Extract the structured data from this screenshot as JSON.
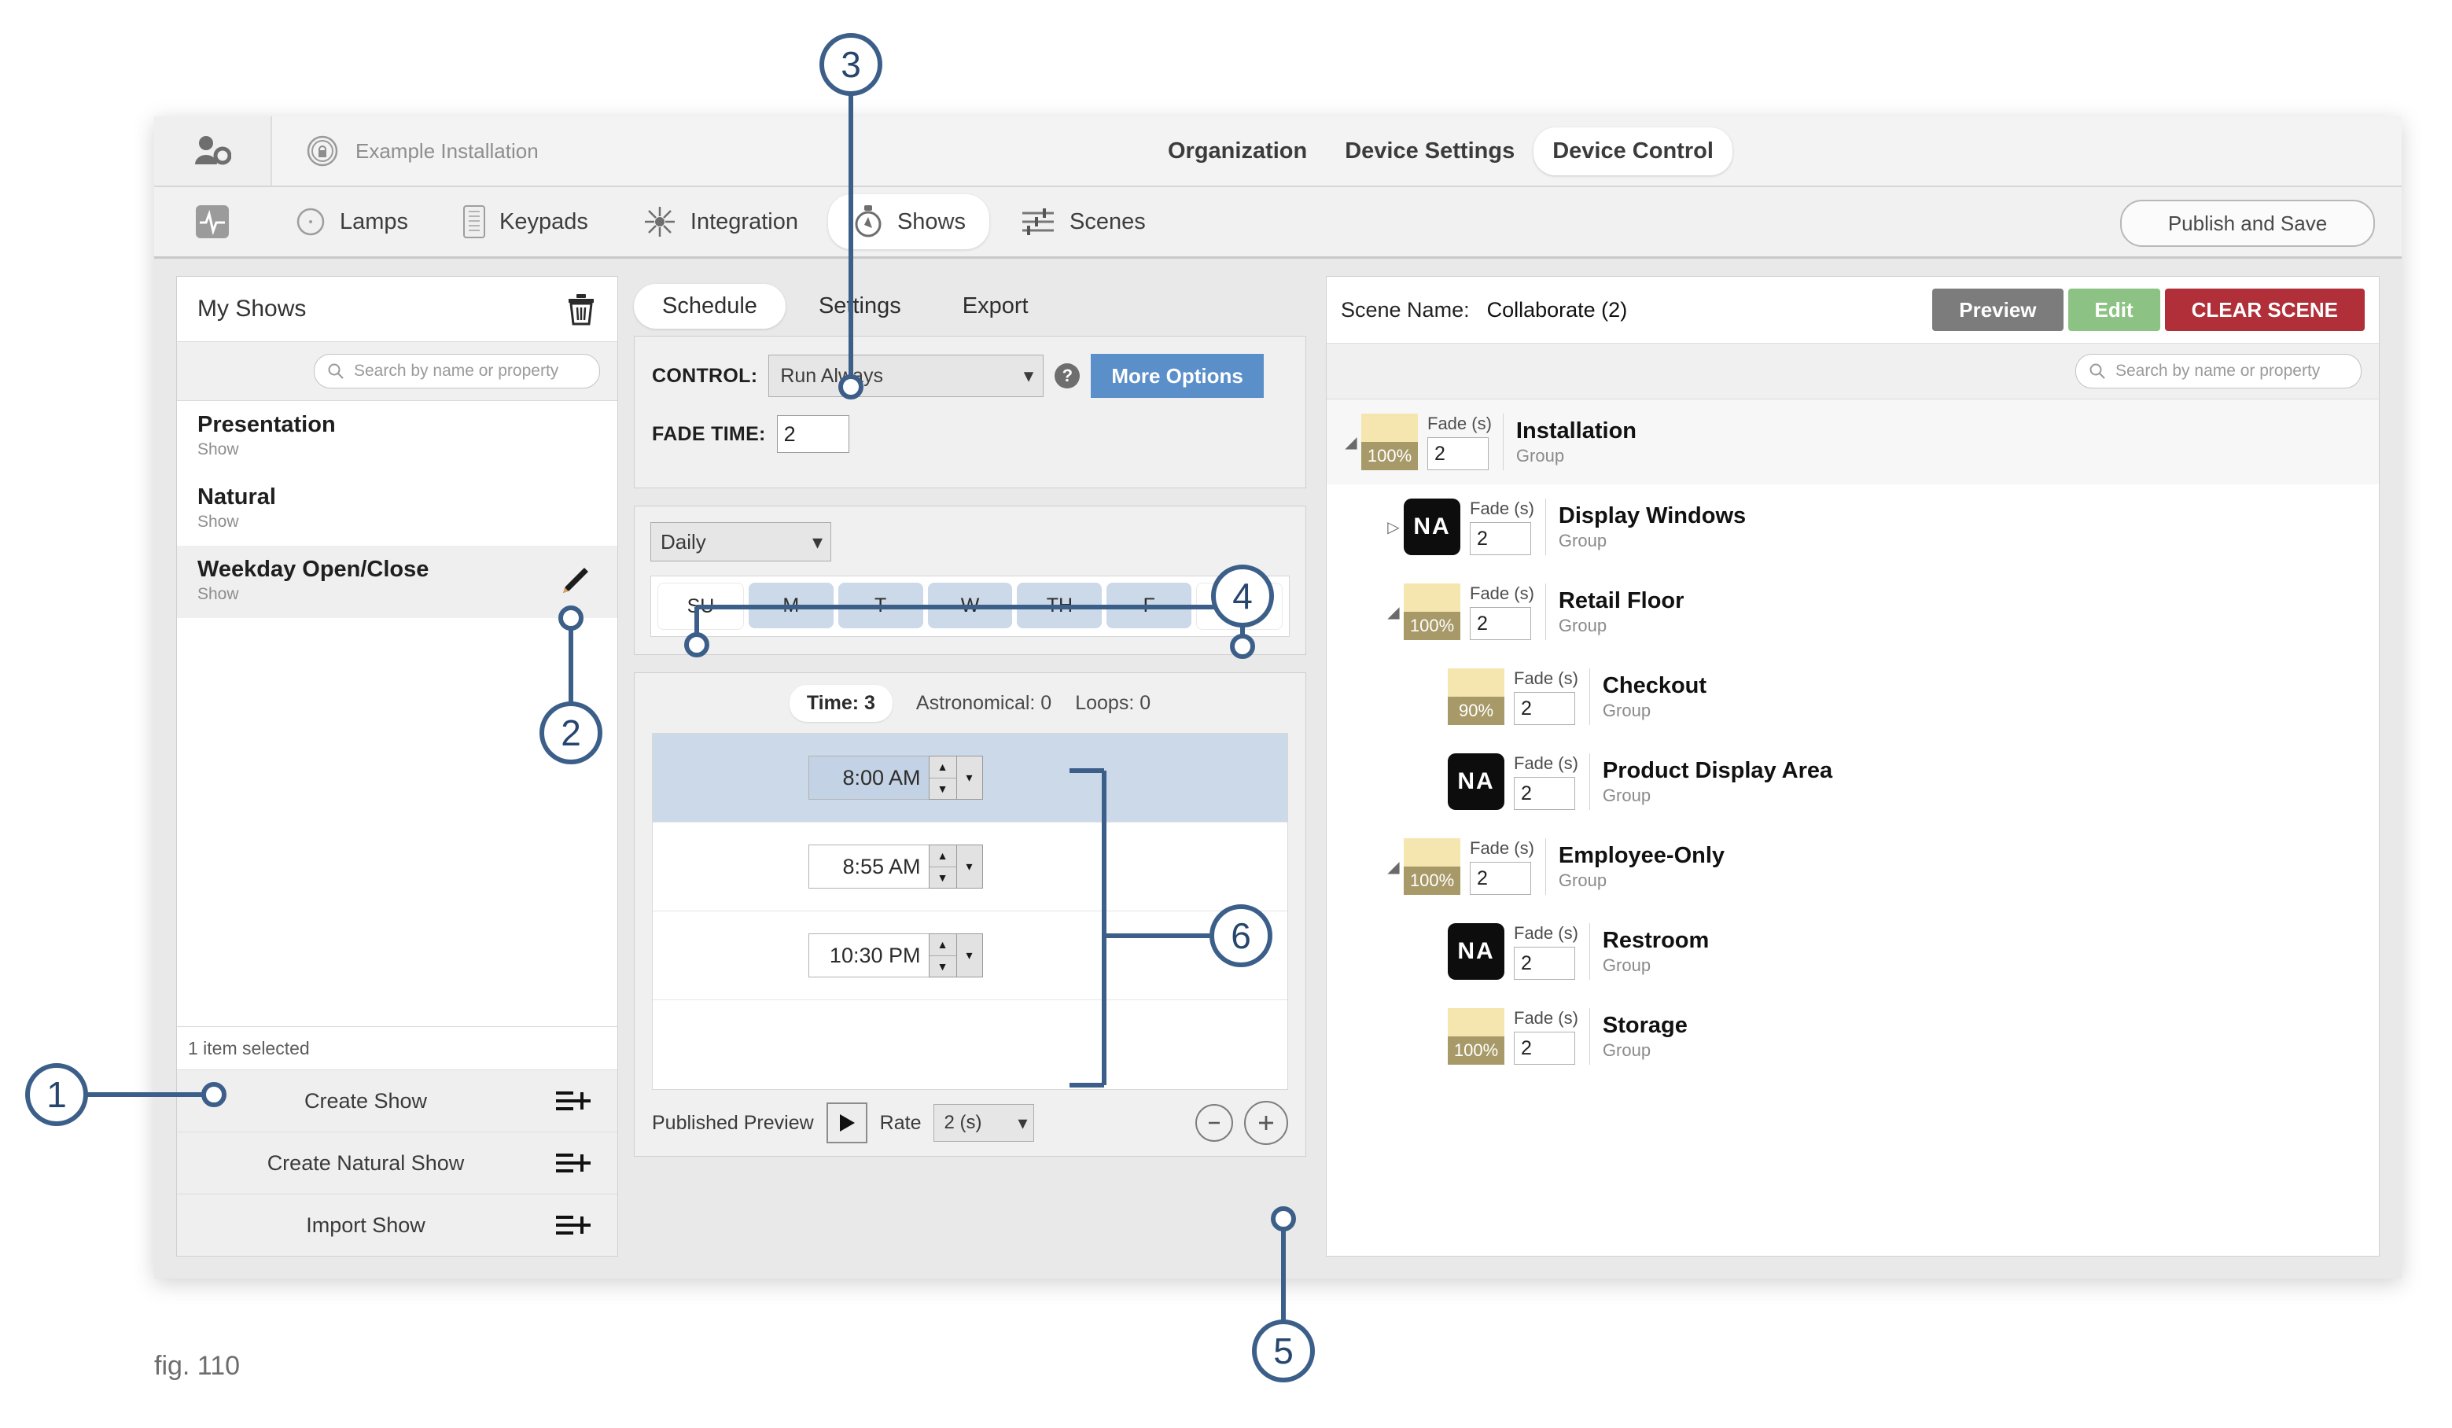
{
  "window": {
    "topbar": {
      "user_settings_icon": "user-gear-icon",
      "installation_icon": "installation-lock-icon",
      "installation_name": "Example Installation",
      "nav": [
        {
          "label": "Organization",
          "active": false
        },
        {
          "label": "Device Settings",
          "active": false
        },
        {
          "label": "Device Control",
          "active": true
        }
      ]
    },
    "secondbar": {
      "status_icon": "pulse-icon",
      "tabs": [
        {
          "label": "Lamps",
          "icon": "lamp-circle-icon",
          "active": false
        },
        {
          "label": "Keypads",
          "icon": "keypad-icon",
          "active": false
        },
        {
          "label": "Integration",
          "icon": "integration-icon",
          "active": false
        },
        {
          "label": "Shows",
          "icon": "stopwatch-icon",
          "active": true
        },
        {
          "label": "Scenes",
          "icon": "sliders-icon",
          "active": false
        }
      ],
      "publish_label": "Publish and Save"
    }
  },
  "left_panel": {
    "title": "My Shows",
    "delete_icon": "trash-icon",
    "search_placeholder": "Search by name or property",
    "shows": [
      {
        "name": "Presentation",
        "type": "Show",
        "selected": false,
        "editable": false
      },
      {
        "name": "Natural",
        "type": "Show",
        "selected": false,
        "editable": false
      },
      {
        "name": "Weekday Open/Close",
        "type": "Show",
        "selected": true,
        "editable": true
      }
    ],
    "status": "1 item selected",
    "actions": [
      {
        "label": "Create Show",
        "icon": "list-plus-icon"
      },
      {
        "label": "Create Natural Show",
        "icon": "list-plus-icon"
      },
      {
        "label": "Import Show",
        "icon": "list-plus-icon"
      }
    ]
  },
  "center_panel": {
    "tabs": [
      {
        "label": "Schedule",
        "active": true
      },
      {
        "label": "Settings",
        "active": false
      },
      {
        "label": "Export",
        "active": false
      }
    ],
    "control": {
      "control_label": "CONTROL:",
      "control_value": "Run Always",
      "help_icon": "question-mark-icon",
      "more_options_label": "More Options",
      "fade_time_label": "FADE TIME:",
      "fade_time_value": "2"
    },
    "recurrence": {
      "frequency_value": "Daily",
      "days": [
        {
          "label": "SU",
          "selected": false
        },
        {
          "label": "M",
          "selected": true
        },
        {
          "label": "T",
          "selected": true
        },
        {
          "label": "W",
          "selected": true
        },
        {
          "label": "TH",
          "selected": true
        },
        {
          "label": "F",
          "selected": true
        },
        {
          "label": "S",
          "selected": false
        }
      ]
    },
    "schedule": {
      "counters": [
        {
          "label": "Time: 3",
          "active": true
        },
        {
          "label": "Astronomical: 0",
          "active": false
        },
        {
          "label": "Loops: 0",
          "active": false
        }
      ],
      "times": [
        {
          "value": "8:00 AM",
          "selected": true
        },
        {
          "value": "8:55 AM",
          "selected": false
        },
        {
          "value": "10:30 PM",
          "selected": false
        }
      ]
    },
    "footer": {
      "preview_label": "Published Preview",
      "play_icon": "play-icon",
      "rate_label": "Rate",
      "rate_value": "2 (s)",
      "zoom_out_icon": "minus-circle-icon",
      "zoom_in_icon": "plus-circle-icon"
    }
  },
  "right_panel": {
    "scene_name_label": "Scene Name:",
    "scene_name_value": "Collaborate (2)",
    "buttons": [
      {
        "label": "Preview",
        "color": "#7c7c7c"
      },
      {
        "label": "Edit",
        "color": "#8cc283"
      },
      {
        "label": "CLEAR SCENE",
        "color": "#b02f38"
      }
    ],
    "search_placeholder": "Search by name or property",
    "fade_label": "Fade (s)",
    "tree": [
      {
        "name": "Installation",
        "type": "Group",
        "level": 0,
        "swatch": "100%",
        "na": false,
        "fade": "2",
        "expander": "down",
        "highlight": true
      },
      {
        "name": "Display Windows",
        "type": "Group",
        "level": 1,
        "swatch": "",
        "na": true,
        "fade": "2",
        "expander": "right",
        "highlight": false
      },
      {
        "name": "Retail Floor",
        "type": "Group",
        "level": 1,
        "swatch": "100%",
        "na": false,
        "fade": "2",
        "expander": "down",
        "highlight": false
      },
      {
        "name": "Checkout",
        "type": "Group",
        "level": 2,
        "swatch": "90%",
        "na": false,
        "fade": "2",
        "expander": "",
        "highlight": false
      },
      {
        "name": "Product Display Area",
        "type": "Group",
        "level": 2,
        "swatch": "",
        "na": true,
        "fade": "2",
        "expander": "",
        "highlight": false
      },
      {
        "name": "Employee-Only",
        "type": "Group",
        "level": 1,
        "swatch": "100%",
        "na": false,
        "fade": "2",
        "expander": "down",
        "highlight": false
      },
      {
        "name": "Restroom",
        "type": "Group",
        "level": 2,
        "swatch": "",
        "na": true,
        "fade": "2",
        "expander": "",
        "highlight": false
      },
      {
        "name": "Storage",
        "type": "Group",
        "level": 2,
        "swatch": "100%",
        "na": false,
        "fade": "2",
        "expander": "",
        "highlight": false
      }
    ]
  },
  "callouts": [
    {
      "number": "1"
    },
    {
      "number": "2"
    },
    {
      "number": "3"
    },
    {
      "number": "4"
    },
    {
      "number": "5"
    },
    {
      "number": "6"
    }
  ],
  "figure_caption": "fig. 110",
  "colors": {
    "accent_blue": "#5b8fc9",
    "callout_blue": "#3c5f8a",
    "selected_row": "#ccd9e8",
    "swatch_cream": "#f5e6b0",
    "swatch_olive": "#a89968",
    "green": "#8cc283",
    "red": "#b02f38",
    "gray_btn": "#7c7c7c"
  }
}
